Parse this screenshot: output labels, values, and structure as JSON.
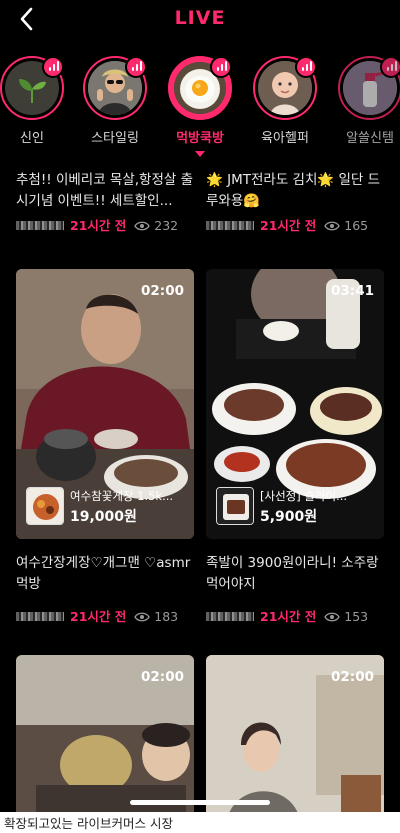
{
  "header": {
    "title": "LIVE"
  },
  "categories": [
    {
      "label": "신인",
      "icon": "sprout-icon"
    },
    {
      "label": "스타일링",
      "icon": "person-sunglasses-icon"
    },
    {
      "label": "먹방쿡방",
      "icon": "fried-egg-icon",
      "active": true
    },
    {
      "label": "육아헬퍼",
      "icon": "baby-icon"
    },
    {
      "label": "알쓸신템",
      "icon": "spray-bottle-icon"
    }
  ],
  "top_posts": [
    {
      "desc": "추첨!!  이베리코 목살,항정살 출시기념 이벤트!! 세트할인...",
      "time": "21시간 전",
      "views": "232"
    },
    {
      "desc": "🌟 JMT전라도 김치🌟 일단 드루와용🤗",
      "time": "21시간 전",
      "views": "165"
    }
  ],
  "videos": [
    {
      "duration": "02:00",
      "product_name": "여수참꽃게장 1.5k...",
      "price": "19,000원",
      "desc": "여수간장게장♡개그맨 ♡asmr먹방",
      "time": "21시간 전",
      "views": "183"
    },
    {
      "duration": "03:41",
      "product_name": "[사선정] 슬라이...",
      "price": "5,900원",
      "desc": "족발이 3900원이라니! 소주랑 먹어야지",
      "time": "21시간 전",
      "views": "153"
    },
    {
      "duration": "02:00"
    },
    {
      "duration": "02:00"
    }
  ],
  "caption": "확장되고있는 라이브커머스 시장",
  "colors": {
    "accent": "#ff2a6d",
    "background": "#000000"
  }
}
